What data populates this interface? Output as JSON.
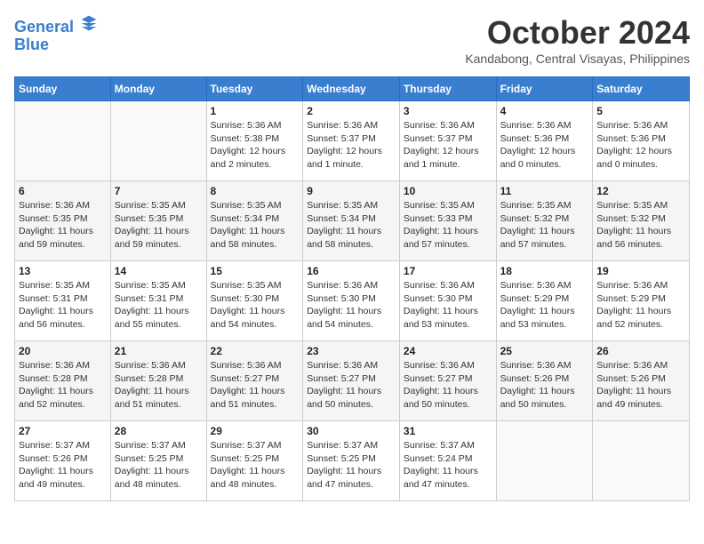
{
  "header": {
    "logo_line1": "General",
    "logo_line2": "Blue",
    "month": "October 2024",
    "location": "Kandabong, Central Visayas, Philippines"
  },
  "weekdays": [
    "Sunday",
    "Monday",
    "Tuesday",
    "Wednesday",
    "Thursday",
    "Friday",
    "Saturday"
  ],
  "weeks": [
    [
      {
        "day": "",
        "detail": ""
      },
      {
        "day": "",
        "detail": ""
      },
      {
        "day": "1",
        "detail": "Sunrise: 5:36 AM\nSunset: 5:38 PM\nDaylight: 12 hours\nand 2 minutes."
      },
      {
        "day": "2",
        "detail": "Sunrise: 5:36 AM\nSunset: 5:37 PM\nDaylight: 12 hours\nand 1 minute."
      },
      {
        "day": "3",
        "detail": "Sunrise: 5:36 AM\nSunset: 5:37 PM\nDaylight: 12 hours\nand 1 minute."
      },
      {
        "day": "4",
        "detail": "Sunrise: 5:36 AM\nSunset: 5:36 PM\nDaylight: 12 hours\nand 0 minutes."
      },
      {
        "day": "5",
        "detail": "Sunrise: 5:36 AM\nSunset: 5:36 PM\nDaylight: 12 hours\nand 0 minutes."
      }
    ],
    [
      {
        "day": "6",
        "detail": "Sunrise: 5:36 AM\nSunset: 5:35 PM\nDaylight: 11 hours\nand 59 minutes."
      },
      {
        "day": "7",
        "detail": "Sunrise: 5:35 AM\nSunset: 5:35 PM\nDaylight: 11 hours\nand 59 minutes."
      },
      {
        "day": "8",
        "detail": "Sunrise: 5:35 AM\nSunset: 5:34 PM\nDaylight: 11 hours\nand 58 minutes."
      },
      {
        "day": "9",
        "detail": "Sunrise: 5:35 AM\nSunset: 5:34 PM\nDaylight: 11 hours\nand 58 minutes."
      },
      {
        "day": "10",
        "detail": "Sunrise: 5:35 AM\nSunset: 5:33 PM\nDaylight: 11 hours\nand 57 minutes."
      },
      {
        "day": "11",
        "detail": "Sunrise: 5:35 AM\nSunset: 5:32 PM\nDaylight: 11 hours\nand 57 minutes."
      },
      {
        "day": "12",
        "detail": "Sunrise: 5:35 AM\nSunset: 5:32 PM\nDaylight: 11 hours\nand 56 minutes."
      }
    ],
    [
      {
        "day": "13",
        "detail": "Sunrise: 5:35 AM\nSunset: 5:31 PM\nDaylight: 11 hours\nand 56 minutes."
      },
      {
        "day": "14",
        "detail": "Sunrise: 5:35 AM\nSunset: 5:31 PM\nDaylight: 11 hours\nand 55 minutes."
      },
      {
        "day": "15",
        "detail": "Sunrise: 5:35 AM\nSunset: 5:30 PM\nDaylight: 11 hours\nand 54 minutes."
      },
      {
        "day": "16",
        "detail": "Sunrise: 5:36 AM\nSunset: 5:30 PM\nDaylight: 11 hours\nand 54 minutes."
      },
      {
        "day": "17",
        "detail": "Sunrise: 5:36 AM\nSunset: 5:30 PM\nDaylight: 11 hours\nand 53 minutes."
      },
      {
        "day": "18",
        "detail": "Sunrise: 5:36 AM\nSunset: 5:29 PM\nDaylight: 11 hours\nand 53 minutes."
      },
      {
        "day": "19",
        "detail": "Sunrise: 5:36 AM\nSunset: 5:29 PM\nDaylight: 11 hours\nand 52 minutes."
      }
    ],
    [
      {
        "day": "20",
        "detail": "Sunrise: 5:36 AM\nSunset: 5:28 PM\nDaylight: 11 hours\nand 52 minutes."
      },
      {
        "day": "21",
        "detail": "Sunrise: 5:36 AM\nSunset: 5:28 PM\nDaylight: 11 hours\nand 51 minutes."
      },
      {
        "day": "22",
        "detail": "Sunrise: 5:36 AM\nSunset: 5:27 PM\nDaylight: 11 hours\nand 51 minutes."
      },
      {
        "day": "23",
        "detail": "Sunrise: 5:36 AM\nSunset: 5:27 PM\nDaylight: 11 hours\nand 50 minutes."
      },
      {
        "day": "24",
        "detail": "Sunrise: 5:36 AM\nSunset: 5:27 PM\nDaylight: 11 hours\nand 50 minutes."
      },
      {
        "day": "25",
        "detail": "Sunrise: 5:36 AM\nSunset: 5:26 PM\nDaylight: 11 hours\nand 50 minutes."
      },
      {
        "day": "26",
        "detail": "Sunrise: 5:36 AM\nSunset: 5:26 PM\nDaylight: 11 hours\nand 49 minutes."
      }
    ],
    [
      {
        "day": "27",
        "detail": "Sunrise: 5:37 AM\nSunset: 5:26 PM\nDaylight: 11 hours\nand 49 minutes."
      },
      {
        "day": "28",
        "detail": "Sunrise: 5:37 AM\nSunset: 5:25 PM\nDaylight: 11 hours\nand 48 minutes."
      },
      {
        "day": "29",
        "detail": "Sunrise: 5:37 AM\nSunset: 5:25 PM\nDaylight: 11 hours\nand 48 minutes."
      },
      {
        "day": "30",
        "detail": "Sunrise: 5:37 AM\nSunset: 5:25 PM\nDaylight: 11 hours\nand 47 minutes."
      },
      {
        "day": "31",
        "detail": "Sunrise: 5:37 AM\nSunset: 5:24 PM\nDaylight: 11 hours\nand 47 minutes."
      },
      {
        "day": "",
        "detail": ""
      },
      {
        "day": "",
        "detail": ""
      }
    ]
  ]
}
